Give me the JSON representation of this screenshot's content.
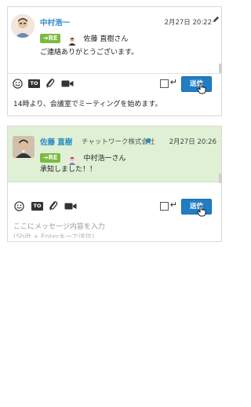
{
  "panel1": {
    "sender": "中村浩一",
    "timestamp": "2月27日 20:22",
    "reply_badge": "➔RE",
    "reply_to": "佐藤 直樹さん",
    "message": "ご連絡ありがとうございます。",
    "send_label": "送信",
    "input_text": "14時より、会議室でミーティングを始めます。"
  },
  "panel2": {
    "sender": "佐藤 直樹",
    "company": "チャットワーク株式会社",
    "timestamp": "2月27日 20:26",
    "reply_badge": "➔RE",
    "reply_to": "中村浩一さん",
    "message": "承知しました！！",
    "send_label": "送信",
    "input_placeholder": "ここにメッセージ内容を入力",
    "input_placeholder_hint": "(Shift + Enterキーで送信)"
  },
  "icons": {
    "emoji": "smiley-icon",
    "to": "to-icon",
    "attach": "paperclip-icon",
    "video": "video-icon",
    "enter": "enter-icon",
    "edit": "pencil-icon",
    "cursor": "hand-cursor-icon"
  },
  "colors": {
    "accent": "#2c89c6",
    "re_badge": "#7bbb3f",
    "send_button": "#1f7ec4",
    "reply_highlight": "#dff0d4"
  }
}
